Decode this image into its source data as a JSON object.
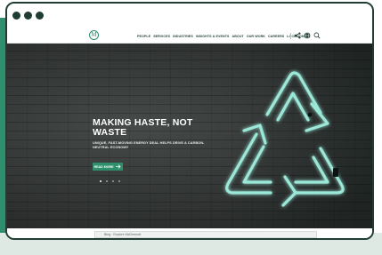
{
  "window": {
    "controls": [
      "dot",
      "dot",
      "dot"
    ]
  },
  "nav": {
    "logo_letter": "M",
    "menu": [
      "PEOPLE",
      "SERVICES",
      "INDUSTRIES",
      "INSIGHTS & EVENTS",
      "ABOUT",
      "OUR WORK",
      "CAREERS",
      "LOCATIONS"
    ],
    "icons": [
      "share-icon",
      "globe-icon",
      "search-icon"
    ]
  },
  "hero": {
    "headline": "MAKING HASTE, NOT WASTE",
    "subhead": "UNIQUE, FAST-MOVING ENERGY DEAL HELPS DRIVE A CARBON-NEUTRAL ECONOMY",
    "cta_label": "READ MORE",
    "pager_count": 4,
    "pager_active_index": 0,
    "neon_color": "#9be8d8",
    "brand_color": "#2f8f6c"
  },
  "bottom_bar": {
    "text": "Bing · Explore McDermott"
  }
}
